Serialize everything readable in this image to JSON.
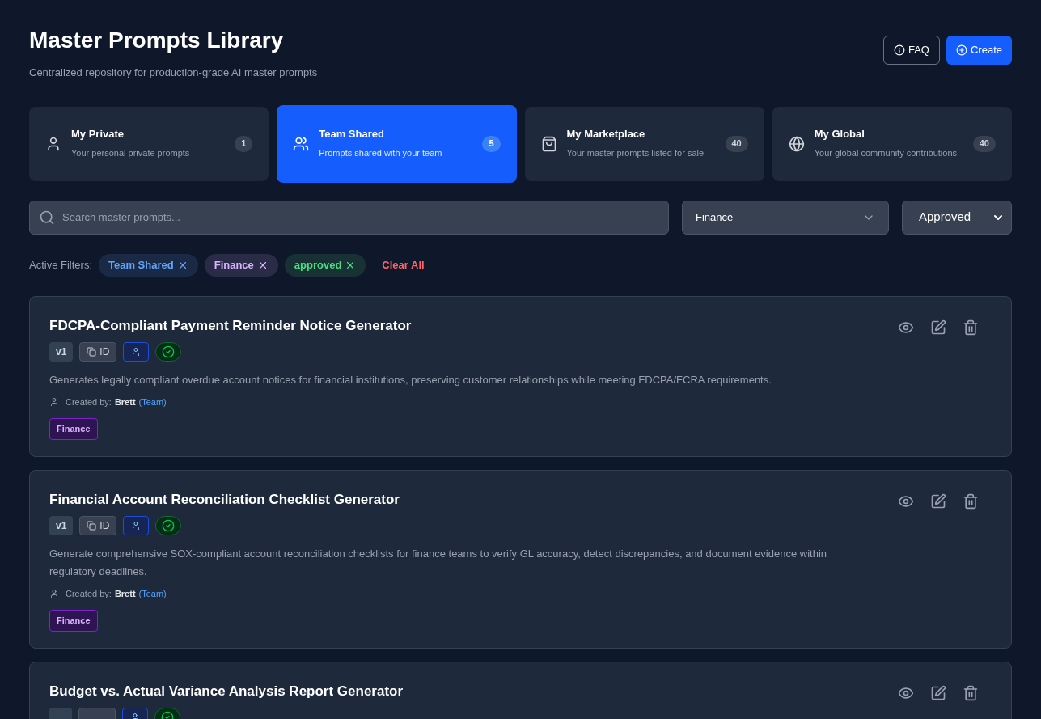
{
  "header": {
    "title": "Master Prompts Library",
    "subtitle": "Centralized repository for production-grade AI master prompts",
    "buttons": [
      {
        "kind": "faq",
        "label": "FAQ"
      },
      {
        "kind": "create",
        "label": "Create"
      }
    ]
  },
  "tabs": [
    {
      "kind": "private",
      "title": "My Private",
      "description": "Your personal private prompts",
      "count": "1",
      "selected": false
    },
    {
      "kind": "team",
      "title": "Team Shared",
      "description": "Prompts shared with your team",
      "count": "5",
      "selected": true
    },
    {
      "kind": "marketplace",
      "title": "My Marketplace",
      "description": "Your master prompts listed for sale",
      "count": "40",
      "selected": false
    },
    {
      "kind": "global",
      "title": "My Global",
      "description": "Your global community contributions",
      "count": "40",
      "selected": false
    }
  ],
  "search": {
    "placeholder": "Search master prompts..."
  },
  "category_select": {
    "value": "Finance"
  },
  "status_select": {
    "value": "Approved"
  },
  "active_filters": {
    "label": "Active Filters:",
    "chips": [
      {
        "label": "Team Shared",
        "color": "#60a5fa"
      },
      {
        "label": "Finance",
        "color": "#d8b4fe"
      },
      {
        "label": "approved",
        "color": "#4ade80"
      }
    ],
    "clear": "Clear All"
  },
  "prompts": [
    {
      "title": "FDCPA-Compliant Payment Reminder Notice Generator",
      "version": "v1",
      "id_label": "ID",
      "description": "Generates legally compliant overdue account notices for financial institutions, preserving customer relationships while meeting FDCPA/FCRA requirements.",
      "created_label": "Created by:",
      "author": "Brett",
      "scope": "(Team)",
      "tag": "Finance"
    },
    {
      "title": "Financial Account Reconciliation Checklist Generator",
      "version": "v1",
      "id_label": "ID",
      "description": "Generate comprehensive SOX-compliant account reconciliation checklists for finance teams to verify GL accuracy, detect discrepancies, and document evidence within regulatory deadlines.",
      "created_label": "Created by:",
      "author": "Brett",
      "scope": "(Team)",
      "tag": "Finance"
    },
    {
      "title": "Budget vs. Actual Variance Analysis Report Generator"
    }
  ]
}
